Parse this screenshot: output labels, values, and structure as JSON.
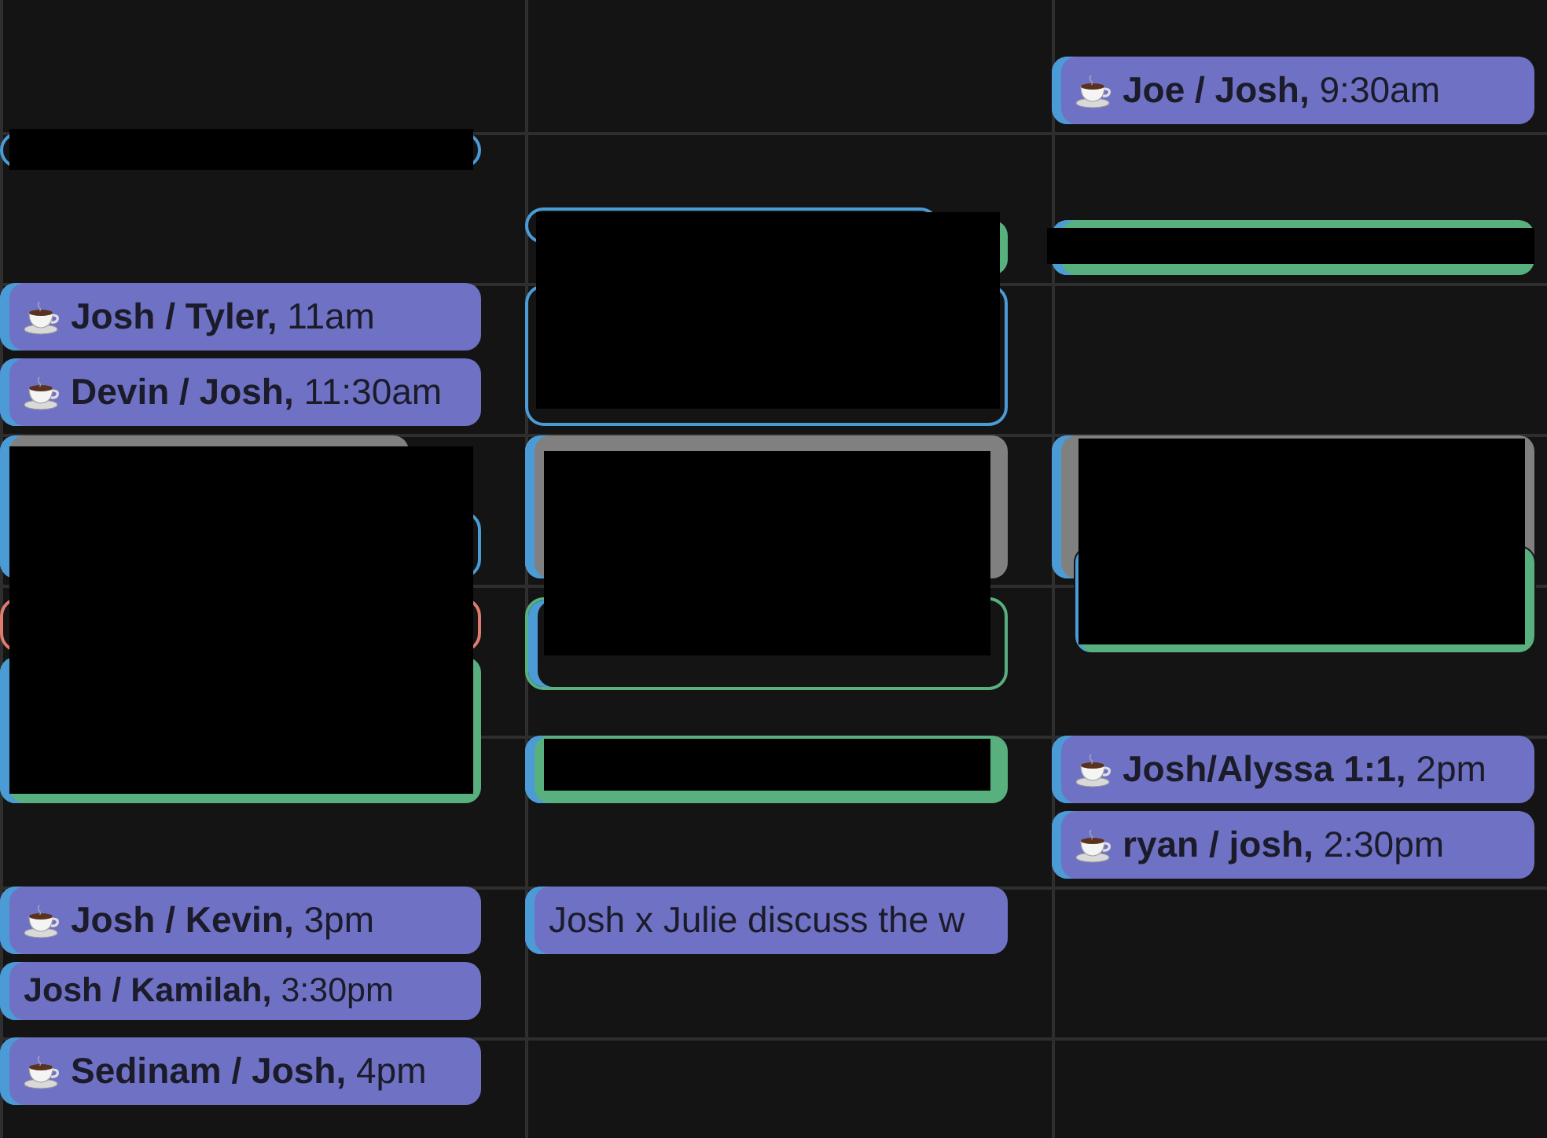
{
  "columns": [
    {
      "events": [
        {
          "kind": "outlined",
          "color": "#4b9bd6",
          "stripe": false,
          "redacted": true
        },
        {
          "kind": "filled",
          "color": "#6f72c4",
          "stripe": true,
          "emoji_icon": true,
          "title": "**Josh / Tyler,** 11am",
          "redacted": false
        },
        {
          "kind": "filled",
          "color": "#6f72c4",
          "stripe": true,
          "emoji_icon": true,
          "title": "**Devin / Josh,** 11:30am",
          "redacted": false
        },
        {
          "kind": "filled",
          "color": "#808080",
          "stripe": true,
          "redacted": true
        },
        {
          "kind": "outlined",
          "color": "#4b9bd6"
        },
        {
          "kind": "outlined",
          "color": "#e07b6f",
          "stripe": false
        },
        {
          "kind": "filled",
          "color": "#58b07e",
          "stripe": true
        },
        {
          "kind": "filled",
          "color": "#6f72c4",
          "stripe": true,
          "emoji_icon": true,
          "title": "**Josh / Kevin,** 3pm",
          "redacted": false
        },
        {
          "kind": "filled",
          "color": "#6f72c4",
          "stripe": true,
          "emoji_icon": false,
          "title": "**Josh / Kamilah,** 3:30pm",
          "redacted": false
        },
        {
          "kind": "filled",
          "color": "#6f72c4",
          "stripe": true,
          "emoji_icon": true,
          "title": "**Sedinam / Josh,** 4pm",
          "redacted": false
        }
      ]
    },
    {
      "events": [
        {
          "kind": "outlined",
          "color": "#4b9bd6",
          "stripe": false,
          "redacted": true
        },
        {
          "kind": "filled",
          "color": "#58b07e"
        },
        {
          "kind": "outlined",
          "color": "#4b9bd6",
          "stripe": false
        },
        {
          "kind": "filled",
          "color": "#808080",
          "stripe": true,
          "redacted": true
        },
        {
          "kind": "outlined",
          "color": "#58b07e",
          "stripe": true
        },
        {
          "kind": "filled",
          "color": "#58b07e",
          "stripe": true,
          "redacted": true
        },
        {
          "kind": "filled",
          "color": "#6f72c4",
          "stripe": true,
          "emoji_icon": false,
          "title": "Josh x Julie discuss the w",
          "redacted": false
        }
      ]
    },
    {
      "events": [
        {
          "kind": "filled",
          "color": "#6f72c4",
          "stripe": true,
          "emoji_icon": true,
          "title": "**Joe / Josh,** 9:30am",
          "redacted": false
        },
        {
          "kind": "filled",
          "color": "#58b07e",
          "stripe": true,
          "redacted": true
        },
        {
          "kind": "filled",
          "color": "#808080",
          "stripe": true,
          "redacted": true
        },
        {
          "kind": "filled",
          "color": "#58b07e",
          "stripe": true
        },
        {
          "kind": "filled",
          "color": "#6f72c4",
          "stripe": true,
          "emoji_icon": true,
          "title": "**Josh/Alyssa 1:1,** 2pm",
          "redacted": false
        },
        {
          "kind": "filled",
          "color": "#6f72c4",
          "stripe": true,
          "emoji_icon": true,
          "title": "**ryan / josh,** 2:30pm",
          "redacted": false
        }
      ]
    }
  ]
}
